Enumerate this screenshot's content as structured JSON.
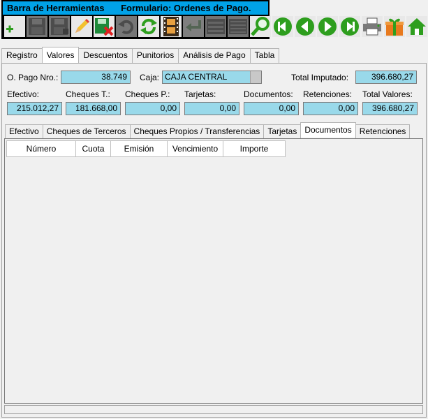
{
  "toolbar": {
    "title": "Barra de Herramientas",
    "form_title": "Formulario: Ordenes de Pago.",
    "buttons": [
      {
        "icon": "add-icon"
      },
      {
        "icon": "save-icon"
      },
      {
        "icon": "save-as-icon"
      },
      {
        "icon": "edit-pencil-icon"
      },
      {
        "icon": "delete-icon"
      },
      {
        "icon": "undo-icon"
      },
      {
        "icon": "refresh-icon"
      },
      {
        "icon": "film-icon"
      },
      {
        "icon": "return-icon"
      },
      {
        "icon": "list-icon"
      },
      {
        "icon": "grid-icon"
      },
      {
        "icon": "search-icon"
      },
      {
        "icon": "first-record-icon"
      },
      {
        "icon": "previous-record-icon"
      },
      {
        "icon": "next-record-icon"
      },
      {
        "icon": "last-record-icon"
      },
      {
        "icon": "print-icon"
      },
      {
        "icon": "gift-icon"
      },
      {
        "icon": "home-icon"
      }
    ]
  },
  "top_tabs": [
    "Registro",
    "Valores",
    "Descuentos",
    "Punitorios",
    "Análisis de Pago",
    "Tabla"
  ],
  "top_tabs_active": "Valores",
  "header": {
    "opago_label": "O. Pago Nro.:",
    "opago_value": "38.749",
    "caja_label": "Caja:",
    "caja_value": "CAJA CENTRAL",
    "total_imputado_label": "Total Imputado:",
    "total_imputado_value": "396.680,27"
  },
  "values_row": [
    {
      "label": "Efectivo:",
      "value": "215.012,27"
    },
    {
      "label": "Cheques T.:",
      "value": "181.668,00"
    },
    {
      "label": "Cheques P.:",
      "value": "0,00"
    },
    {
      "label": "Tarjetas:",
      "value": "0,00"
    },
    {
      "label": "Documentos:",
      "value": "0,00"
    },
    {
      "label": "Retenciones:",
      "value": "0,00"
    },
    {
      "label": "Total Valores:",
      "value": "396.680,27"
    }
  ],
  "inner_tabs": [
    "Efectivo",
    "Cheques de Terceros",
    "Cheques Propios / Transferencias",
    "Tarjetas",
    "Documentos",
    "Retenciones"
  ],
  "inner_tabs_active": "Documentos",
  "grid": {
    "columns": [
      "Número",
      "Cuota",
      "Emisión",
      "Vencimiento",
      "Importe"
    ]
  },
  "colors": {
    "title_bar": "#00a2e8",
    "field_bg": "#99d9ea",
    "nav_green": "#2e9e1e"
  }
}
